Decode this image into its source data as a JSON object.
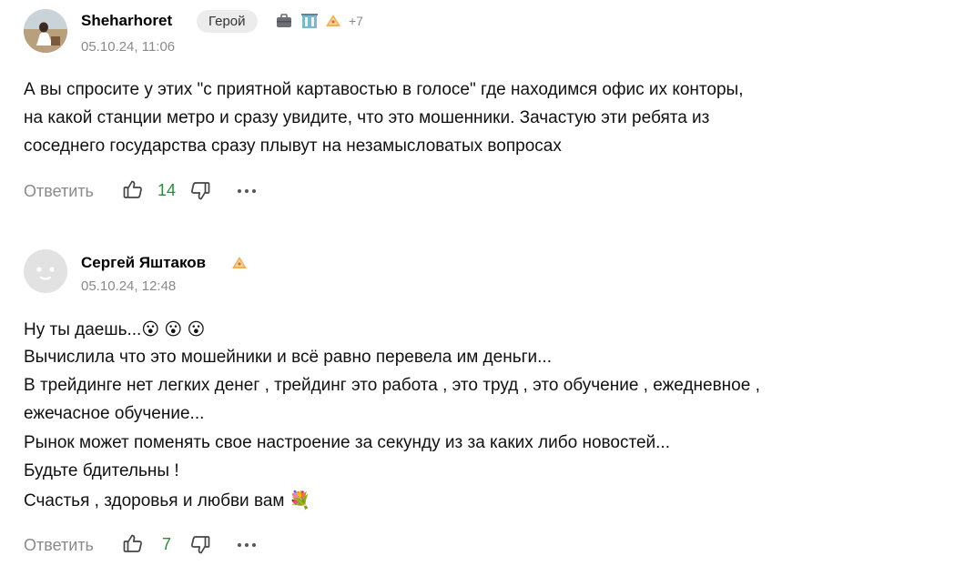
{
  "comments": [
    {
      "author": "Sheharhoret",
      "badge": "Герой",
      "awards_icons": [
        "briefcase-icon",
        "building-icon",
        "pastry-icon"
      ],
      "awards_more": "+7",
      "date": "05.10.24, 11:06",
      "lines": [
        "А вы спросите у этих \"с приятной картавостью в голосе\" где находимся офис их конторы,",
        "на какой станции метро и сразу увидите, что это мошенники. Зачастую эти ребята из",
        "соседнего государства сразу плывут на незамысловатых вопросах"
      ],
      "reply_label": "Ответить",
      "likes": "14"
    },
    {
      "author": "Сергей Яштаков",
      "awards_icons": [
        "pastry-icon"
      ],
      "date": "05.10.24, 12:48",
      "lines": [
        "Ну ты даешь...😮 😮 😮",
        "Вычислила что это мошейники и всё равно перевела им деньги...",
        "В трейдинге нет легких денег , трейдинг это работа , это труд , это обучение , ежедневное ,",
        "ежечасное обучение...",
        "Рынок может поменять свое настроение за секунду из за каких либо новостей...",
        "Будьте бдительны !",
        "Счастья , здоровья и любви вам 💐"
      ],
      "reply_label": "Ответить",
      "likes": "7"
    }
  ],
  "colors": {
    "likes": "#2e8a3d",
    "meta": "#8a8a8a",
    "badge_bg": "#ececec"
  }
}
